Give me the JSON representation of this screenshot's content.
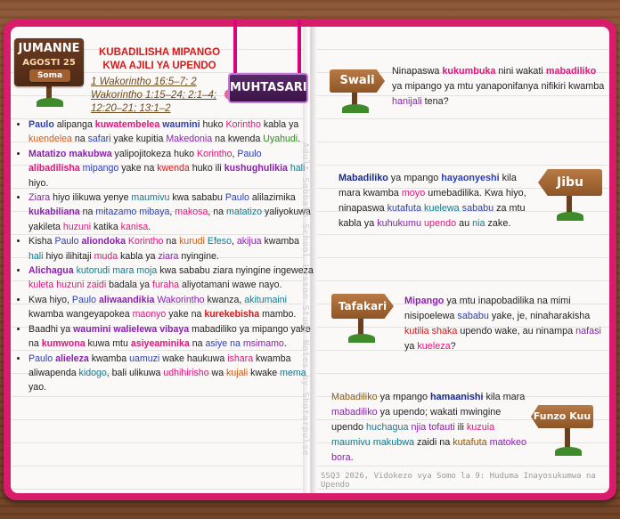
{
  "left": {
    "date": {
      "day": "JUMANNE",
      "date": "AGOSTI 25",
      "read": "Soma"
    },
    "title": "KUBADILISHA MIPANGO KWA AJILI YA UPENDO",
    "refs": [
      "1 Wakorintho 16:5–7; 2",
      "Wakorintho 1:15–24; 2:1–4;",
      "12:20–21; 13:1–2"
    ],
    "summary_label": "MUHTASARI",
    "bullets": [
      [
        [
          "Paulo",
          "p c-blue"
        ],
        [
          " alipanga ",
          ""
        ],
        [
          "kuwatembelea",
          "p c-pink"
        ],
        [
          " ",
          ""
        ],
        [
          "waumini",
          "p c-blue"
        ],
        [
          " huko ",
          ""
        ],
        [
          "Korintho",
          "c-pink"
        ],
        [
          " kabla ya ",
          ""
        ],
        [
          "kuendelea",
          "c-orange"
        ],
        [
          " na ",
          ""
        ],
        [
          "safari",
          "c-blue"
        ],
        [
          " yake kupitia ",
          ""
        ],
        [
          "Makedonia",
          "c-purple"
        ],
        [
          " na kwenda ",
          ""
        ],
        [
          "Uyahudi",
          "c-green"
        ],
        [
          ".",
          ""
        ]
      ],
      [
        [
          "Matatizo makubwa",
          "p c-purple"
        ],
        [
          " yalipojitokeza huko ",
          ""
        ],
        [
          "Korintho",
          "c-pink"
        ],
        [
          ", ",
          ""
        ],
        [
          "Paulo",
          "c-blue"
        ],
        [
          " ",
          ""
        ],
        [
          "alibadilisha",
          "p c-pink"
        ],
        [
          " ",
          ""
        ],
        [
          "mipango",
          "c-blue"
        ],
        [
          " yake na ",
          ""
        ],
        [
          "kwenda",
          "c-red"
        ],
        [
          " huko ili ",
          ""
        ],
        [
          "kushughulikia",
          "p c-purple"
        ],
        [
          " ",
          ""
        ],
        [
          "hali",
          "c-teal"
        ],
        [
          " hiyo.",
          ""
        ]
      ],
      [
        [
          "Ziara",
          "c-purple"
        ],
        [
          " hiyo ilikuwa yenye ",
          ""
        ],
        [
          "maumivu",
          "c-teal"
        ],
        [
          " kwa sababu ",
          ""
        ],
        [
          "Paulo",
          "c-blue"
        ],
        [
          " alilazimika ",
          ""
        ],
        [
          "kukabiliana",
          "p c-purple"
        ],
        [
          " na ",
          ""
        ],
        [
          "mitazamo mibaya",
          "c-blue"
        ],
        [
          ", ",
          ""
        ],
        [
          "makosa",
          "c-pink"
        ],
        [
          ", na ",
          ""
        ],
        [
          "matatizo",
          "c-teal"
        ],
        [
          " yaliyokuwa yakileta ",
          ""
        ],
        [
          "huzuni",
          "c-pink"
        ],
        [
          " katika ",
          ""
        ],
        [
          "kanisa",
          "c-pink"
        ],
        [
          ".",
          ""
        ]
      ],
      [
        [
          "Kisha ",
          ""
        ],
        [
          "Paulo",
          "c-blue"
        ],
        [
          " ",
          ""
        ],
        [
          "aliondoka",
          "p c-purple"
        ],
        [
          " ",
          ""
        ],
        [
          "Korintho",
          "c-pink"
        ],
        [
          " na ",
          ""
        ],
        [
          "kurudi",
          "c-orange"
        ],
        [
          " ",
          ""
        ],
        [
          "Efeso",
          "c-teal"
        ],
        [
          ", ",
          ""
        ],
        [
          "akijua",
          "c-purple"
        ],
        [
          " kwamba ",
          ""
        ],
        [
          "hali",
          "c-teal"
        ],
        [
          " hiyo ilihitaji ",
          ""
        ],
        [
          "muda",
          "c-pink"
        ],
        [
          " kabla ya ",
          ""
        ],
        [
          "ziara",
          "c-purple"
        ],
        [
          " nyingine.",
          ""
        ]
      ],
      [
        [
          "Alichagua",
          "p c-purple"
        ],
        [
          " ",
          ""
        ],
        [
          "kutorudi mara moja",
          "c-teal"
        ],
        [
          " kwa sababu ziara nyingine ingeweza ",
          ""
        ],
        [
          "kuleta",
          "c-pink"
        ],
        [
          " ",
          ""
        ],
        [
          "huzuni zaidi",
          "c-pink"
        ],
        [
          " badala ya ",
          ""
        ],
        [
          "furaha",
          "c-pink"
        ],
        [
          " aliyotamani wawe nayo.",
          ""
        ]
      ],
      [
        [
          "Kwa hiyo, ",
          ""
        ],
        [
          "Paulo",
          "c-blue"
        ],
        [
          " ",
          ""
        ],
        [
          "aliwaandikia",
          "p c-purple"
        ],
        [
          " ",
          ""
        ],
        [
          "Wakorintho",
          "c-purple"
        ],
        [
          " kwanza, ",
          ""
        ],
        [
          "akitumaini",
          "c-teal"
        ],
        [
          " kwamba wangeyapokea ",
          ""
        ],
        [
          "maonyo",
          "c-pink"
        ],
        [
          " yake na ",
          ""
        ],
        [
          "kurekebisha",
          "p c-red"
        ],
        [
          " mambo.",
          ""
        ]
      ],
      [
        [
          "Baadhi ya ",
          ""
        ],
        [
          "waumini walielewa vibaya",
          "p c-purple"
        ],
        [
          " mabadiliko ya mipango yake na ",
          ""
        ],
        [
          "kumwona",
          "p c-pink"
        ],
        [
          " kuwa mtu ",
          ""
        ],
        [
          "asiyeaminika",
          "p c-pink"
        ],
        [
          " na ",
          ""
        ],
        [
          "asiye na",
          "c-blue"
        ],
        [
          " ",
          ""
        ],
        [
          "msimamo",
          "c-purple"
        ],
        [
          ".",
          ""
        ]
      ],
      [
        [
          "Paulo",
          "c-blue"
        ],
        [
          " ",
          ""
        ],
        [
          "alieleza",
          "p c-purple"
        ],
        [
          " kwamba ",
          ""
        ],
        [
          "uamuzi",
          "c-blue"
        ],
        [
          " wake haukuwa ",
          ""
        ],
        [
          "ishara",
          "c-pink"
        ],
        [
          " kwamba aliwapenda ",
          ""
        ],
        [
          "kidogo",
          "c-teal"
        ],
        [
          ", bali ulikuwa ",
          ""
        ],
        [
          "udhihirisho",
          "c-pink"
        ],
        [
          " wa ",
          ""
        ],
        [
          "kujali",
          "c-orange"
        ],
        [
          " kwake ",
          ""
        ],
        [
          "mema",
          "c-teal"
        ],
        [
          " yao.",
          ""
        ]
      ]
    ]
  },
  "right": {
    "vertical_note": "Adult Sabbath School Lesson Study Notes by Shotarpulse",
    "swali_label": "Swali",
    "swali": [
      [
        "Ninapaswa ",
        ""
      ],
      [
        "kukumbuka",
        "p c-pink"
      ],
      [
        " nini wakati ",
        ""
      ],
      [
        "mabadiliko",
        "p c-pink"
      ],
      [
        " ya mipango ya mtu yanaponifanya nifikiri kwamba ",
        ""
      ],
      [
        "hanijali",
        "c-purple"
      ],
      [
        " tena?",
        ""
      ]
    ],
    "jibu_label": "Jibu",
    "jibu": [
      [
        "Mabadiliko",
        "p c-navy"
      ],
      [
        " ya mpango ",
        ""
      ],
      [
        "hayaonyeshi",
        "p c-blue"
      ],
      [
        " kila mara kwamba ",
        ""
      ],
      [
        "moyo",
        "c-pink"
      ],
      [
        " umebadilika. Kwa hiyo, ninapaswa ",
        ""
      ],
      [
        "kutafuta",
        "c-blue"
      ],
      [
        " ",
        ""
      ],
      [
        "kuelewa",
        "c-teal"
      ],
      [
        " ",
        ""
      ],
      [
        "sababu",
        "c-blue"
      ],
      [
        " za mtu kabla ya ",
        ""
      ],
      [
        "kuhukumu",
        "c-purple"
      ],
      [
        " ",
        ""
      ],
      [
        "upendo",
        "c-pink"
      ],
      [
        " au ",
        ""
      ],
      [
        "nia",
        "c-teal"
      ],
      [
        " zake.",
        ""
      ]
    ],
    "tafakari_label": "Tafakari",
    "tafakari": [
      [
        "Mipango",
        "p c-purple"
      ],
      [
        " ya mtu inapobadilika na mimi nisipoelewa ",
        ""
      ],
      [
        "sababu",
        "c-blue"
      ],
      [
        " yake, je, ninaharakisha ",
        ""
      ],
      [
        "kutilia shaka",
        "c-red"
      ],
      [
        " upendo wake, au ninampa ",
        ""
      ],
      [
        "nafasi",
        "c-purple"
      ],
      [
        " ya ",
        ""
      ],
      [
        "kueleza",
        "c-pink"
      ],
      [
        "?",
        ""
      ]
    ],
    "funzo_label": "Funzo Kuu",
    "funzo": [
      [
        "Mabadiliko",
        "c-brown"
      ],
      [
        " ya mpango ",
        ""
      ],
      [
        "hamaanishi",
        "p c-navy"
      ],
      [
        " kila mara ",
        ""
      ],
      [
        "mabadiliko",
        "c-purple"
      ],
      [
        " ya upendo; wakati mwingine upendo ",
        ""
      ],
      [
        "huchagua",
        "c-teal"
      ],
      [
        " ",
        ""
      ],
      [
        "njia tofauti",
        "c-purple"
      ],
      [
        " ili ",
        ""
      ],
      [
        "kuzuia",
        "c-pink"
      ],
      [
        " ",
        ""
      ],
      [
        "maumivu makubwa",
        "c-teal"
      ],
      [
        " zaidi na ",
        ""
      ],
      [
        "kutafuta",
        "c-brown"
      ],
      [
        " ",
        ""
      ],
      [
        "matokeo bora",
        "c-purple"
      ],
      [
        ".",
        ""
      ]
    ],
    "footer": "SSQ3 2026, Vidokezo vya Somo la 9: Huduma Inayosukumwa na Upendo"
  },
  "colors": {
    "cover": "#d81b6a",
    "page": "#fbf8f8",
    "sign_wood": "#a0622f"
  }
}
